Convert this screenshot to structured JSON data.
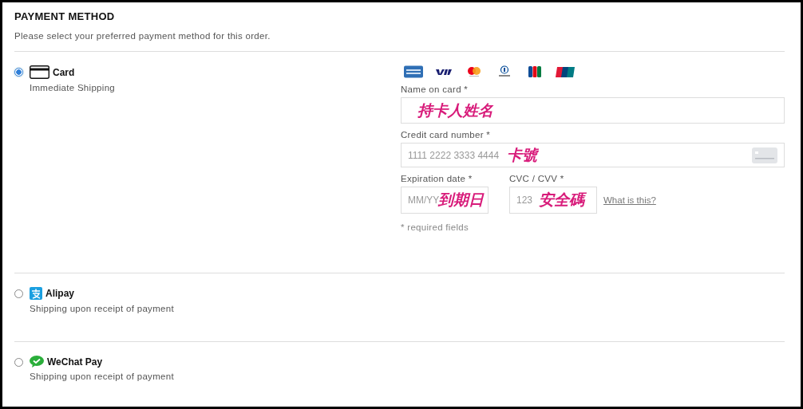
{
  "title": "PAYMENT METHOD",
  "subtitle": "Please select your preferred payment method for this order.",
  "options": [
    {
      "kind": "card",
      "label": "Card",
      "note": "Immediate Shipping",
      "selected": true
    },
    {
      "kind": "alipay",
      "label": "Alipay",
      "note": "Shipping upon receipt of payment",
      "selected": false
    },
    {
      "kind": "wechat",
      "label": "WeChat Pay",
      "note": "Shipping upon receipt of payment",
      "selected": false
    }
  ],
  "card_form": {
    "brands": [
      {
        "kind": "amex"
      },
      {
        "kind": "visa"
      },
      {
        "kind": "mastercard"
      },
      {
        "kind": "diners"
      },
      {
        "kind": "jcb"
      },
      {
        "kind": "unionpay"
      }
    ],
    "name_field": {
      "label": "Name on card *",
      "annotation": "持卡人姓名"
    },
    "number_field": {
      "label": "Credit card number *",
      "placeholder": "1111 2222 3333 4444",
      "annotation": "卡號"
    },
    "expiry_field": {
      "label": "Expiration date *",
      "placeholder": "MM/YY",
      "annotation": "到期日"
    },
    "cvc_field": {
      "label": "CVC / CVV *",
      "placeholder": "123",
      "annotation": "安全碼",
      "help_link": "What is this?"
    },
    "footnote": "* required fields"
  }
}
